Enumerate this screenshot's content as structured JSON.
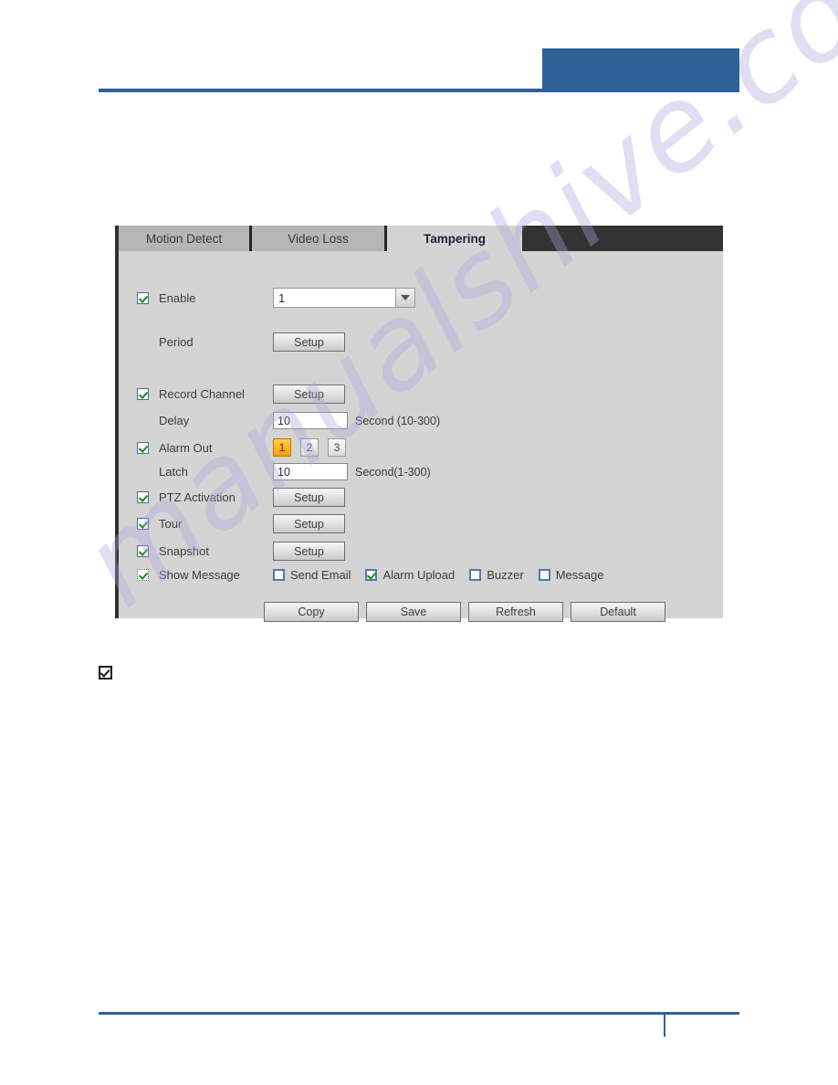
{
  "header": {
    "accent_color": "#2e6198"
  },
  "footer": {
    "accent_color": "#2e6198"
  },
  "watermark": {
    "text": "manualshive.com",
    "color": "#a9a6e0"
  },
  "panel": {
    "tabs": [
      {
        "label": "Motion Detect",
        "active": false
      },
      {
        "label": "Video Loss",
        "active": false
      },
      {
        "label": "Tampering",
        "active": true
      }
    ],
    "fields": {
      "enable": {
        "label": "Enable",
        "checked": true,
        "channel_value": "1"
      },
      "period": {
        "label": "Period",
        "button": "Setup"
      },
      "record_channel": {
        "label": "Record Channel",
        "checked": true,
        "button": "Setup"
      },
      "delay": {
        "label": "Delay",
        "value": "10",
        "unit": "Second (10-300)"
      },
      "alarm_out": {
        "label": "Alarm Out",
        "checked": true,
        "options": [
          "1",
          "2",
          "3"
        ],
        "selected": "1"
      },
      "latch": {
        "label": "Latch",
        "value": "10",
        "unit": "Second(1-300)"
      },
      "ptz_activation": {
        "label": "PTZ Activation",
        "checked": true,
        "button": "Setup"
      },
      "tour": {
        "label": "Tour",
        "checked": true,
        "button": "Setup"
      },
      "snapshot": {
        "label": "Snapshot",
        "checked": true,
        "button": "Setup"
      },
      "show_message": {
        "label": "Show Message",
        "checked": true,
        "focused": true
      }
    },
    "notify_options": [
      {
        "label": "Send Email",
        "checked": false
      },
      {
        "label": "Alarm Upload",
        "checked": true
      },
      {
        "label": "Buzzer",
        "checked": false
      },
      {
        "label": "Message",
        "checked": false
      }
    ],
    "actions": [
      {
        "label": "Copy"
      },
      {
        "label": "Save"
      },
      {
        "label": "Refresh"
      },
      {
        "label": "Default"
      }
    ],
    "accent_selected_color": "#f59b0c",
    "check_color": "#1d8a1d"
  },
  "note": {
    "icon": "checkbox-checked-icon"
  }
}
